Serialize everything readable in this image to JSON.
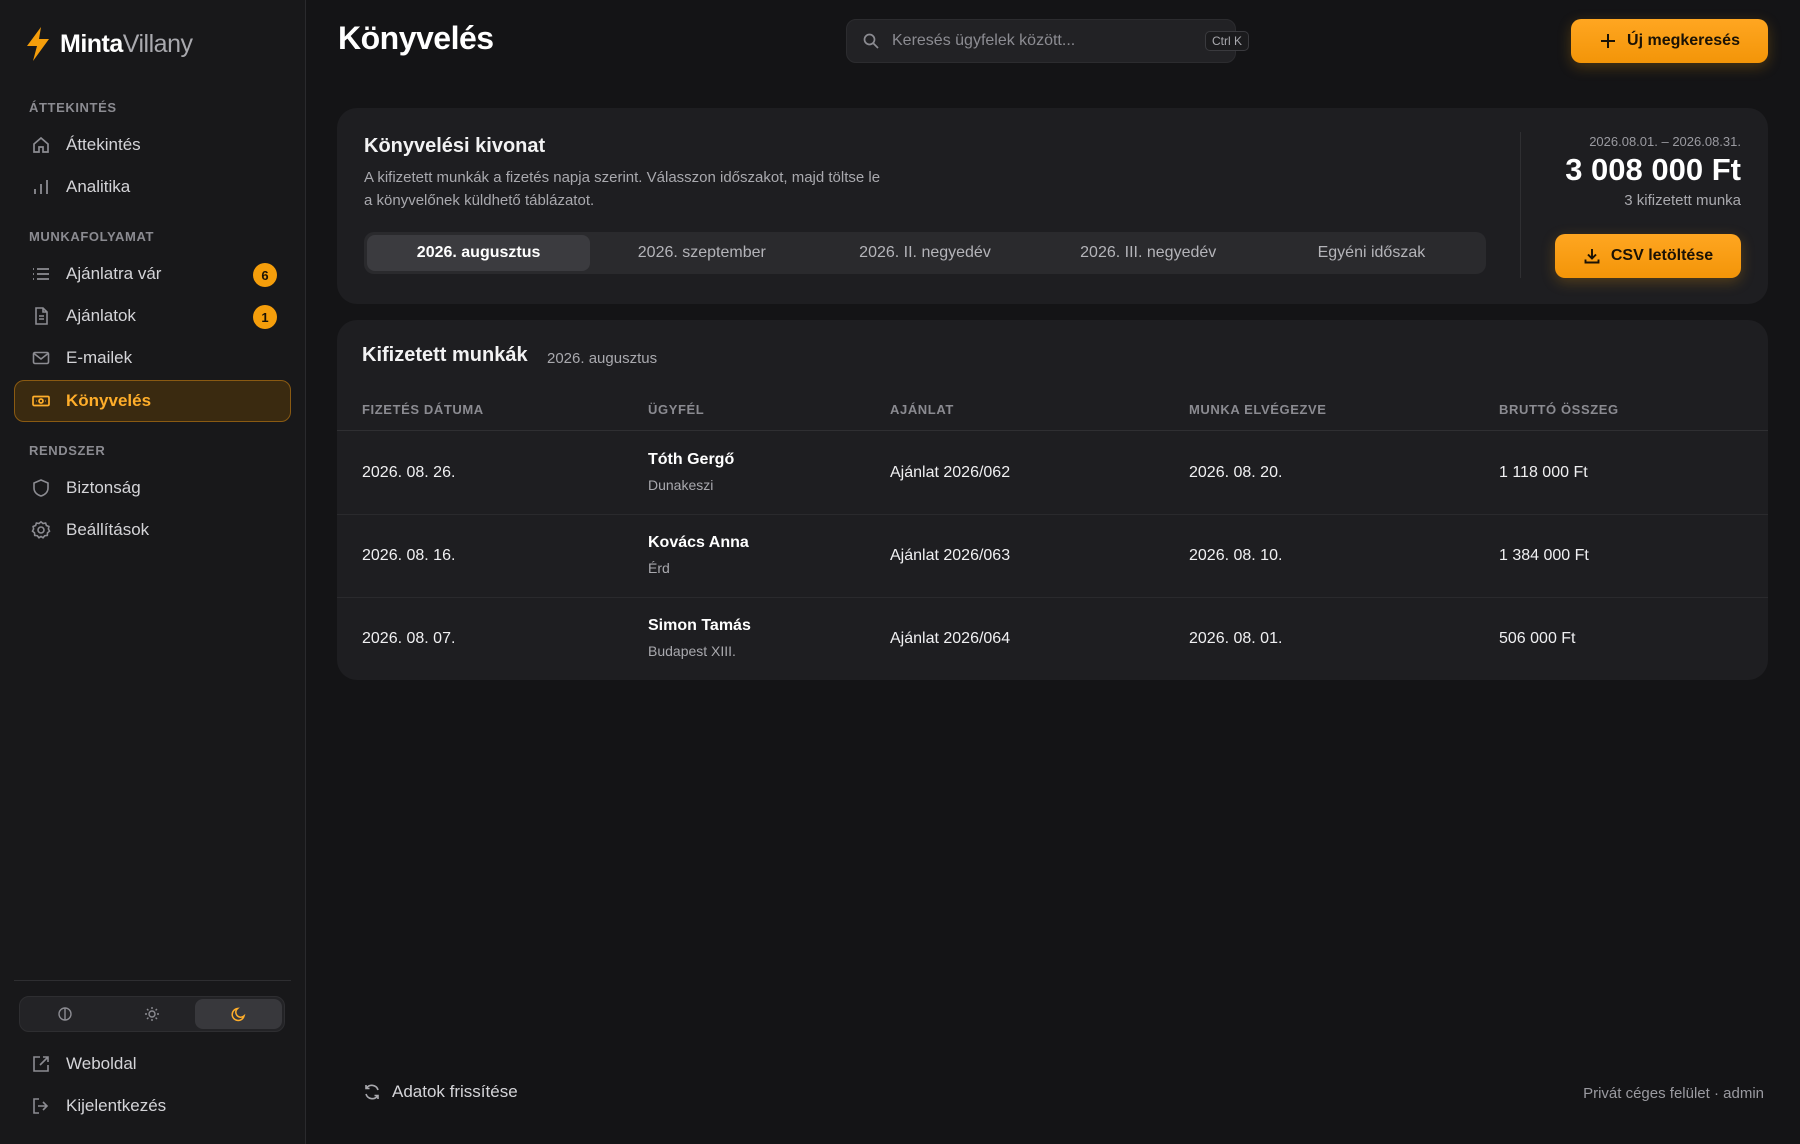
{
  "brand": {
    "name_bold": "Minta",
    "name_light": "Villany"
  },
  "sidebar": {
    "sections": [
      {
        "title": "ÁTTEKINTÉS",
        "items": [
          {
            "label": "Áttekintés",
            "icon": "home-icon"
          },
          {
            "label": "Analitika",
            "icon": "bar-chart-icon"
          }
        ]
      },
      {
        "title": "MUNKAFOLYAMAT",
        "items": [
          {
            "label": "Ajánlatra vár",
            "icon": "list-icon",
            "badge": "6"
          },
          {
            "label": "Ajánlatok",
            "icon": "document-icon",
            "badge": "1"
          },
          {
            "label": "E-mailek",
            "icon": "mail-icon"
          },
          {
            "label": "Könyvelés",
            "icon": "banknote-icon",
            "active": true
          }
        ]
      },
      {
        "title": "RENDSZER",
        "items": [
          {
            "label": "Biztonság",
            "icon": "shield-icon"
          },
          {
            "label": "Beállítások",
            "icon": "gear-icon"
          }
        ]
      }
    ],
    "theme_options": [
      "system",
      "light",
      "dark"
    ],
    "theme_selected": "dark",
    "bottom_items": [
      {
        "label": "Weboldal",
        "icon": "external-link-icon"
      },
      {
        "label": "Kijelentkezés",
        "icon": "logout-icon"
      }
    ]
  },
  "header": {
    "title": "Könyvelés",
    "search_placeholder": "Keresés ügyfelek között...",
    "search_shortcut": "Ctrl K",
    "new_button": "Új megkeresés"
  },
  "summary": {
    "title": "Könyvelési kivonat",
    "description": "A kifizetett munkák a fizetés napja szerint. Válasszon időszakot, majd töltse le a könyvelőnek küldhető táblázatot.",
    "periods": [
      "2026. augusztus",
      "2026. szeptember",
      "2026. II. negyedév",
      "2026. III. negyedév",
      "Egyéni időszak"
    ],
    "selected_period": 0,
    "range": "2026.08.01. – 2026.08.31.",
    "total": "3 008 000 Ft",
    "count_label": "3 kifizetett munka",
    "csv_button": "CSV letöltése"
  },
  "table": {
    "title": "Kifizetett munkák",
    "subtitle": "2026. augusztus",
    "columns": [
      "FIZETÉS DÁTUMA",
      "ÜGYFÉL",
      "AJÁNLAT",
      "MUNKA ELVÉGEZVE",
      "BRUTTÓ ÖSSZEG"
    ],
    "rows": [
      {
        "paid": "2026. 08. 26.",
        "client": "Tóth Gergő",
        "city": "Dunakeszi",
        "offer": "Ajánlat 2026/062",
        "done": "2026. 08. 20.",
        "gross": "1 118 000 Ft"
      },
      {
        "paid": "2026. 08. 16.",
        "client": "Kovács Anna",
        "city": "Érd",
        "offer": "Ajánlat 2026/063",
        "done": "2026. 08. 10.",
        "gross": "1 384 000 Ft"
      },
      {
        "paid": "2026. 08. 07.",
        "client": "Simon Tamás",
        "city": "Budapest XIII.",
        "offer": "Ajánlat 2026/064",
        "done": "2026. 08. 01.",
        "gross": "506 000 Ft"
      }
    ]
  },
  "footer": {
    "refresh": "Adatok frissítése",
    "note": "Privát céges felület · admin"
  },
  "colors": {
    "accent": "#f59e0b",
    "background": "#141416",
    "card": "#1e1e21"
  }
}
